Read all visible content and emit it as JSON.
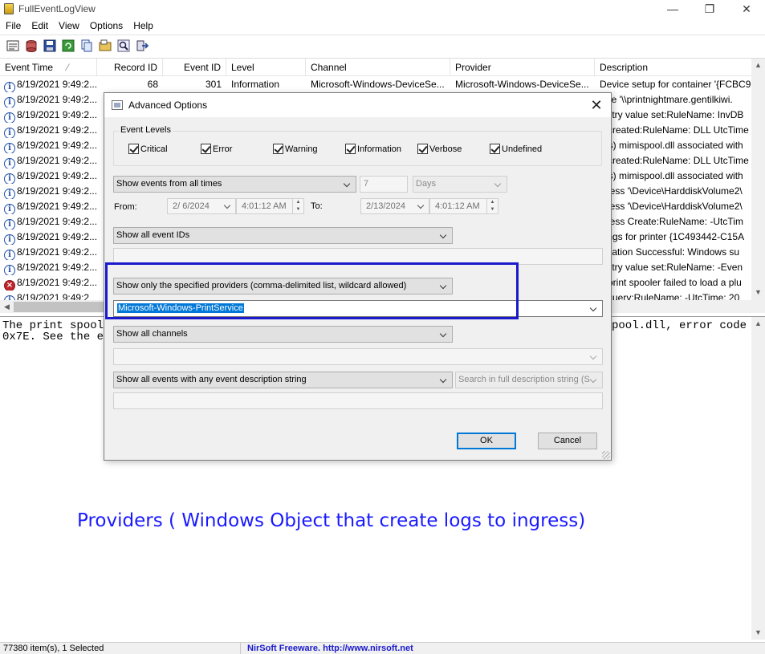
{
  "app": {
    "title": "FullEventLogView",
    "window_buttons": {
      "minimize": "—",
      "maximize": "❐",
      "close": "✕"
    }
  },
  "menu": [
    "File",
    "Edit",
    "View",
    "Options",
    "Help"
  ],
  "toolbar": {
    "icons": [
      "advanced-options-icon",
      "data-source-icon",
      "save-icon",
      "refresh-icon",
      "copy-icon",
      "properties-icon",
      "find-icon",
      "exit-icon"
    ]
  },
  "list": {
    "columns": [
      {
        "label": "Event Time",
        "sort_indicator": "⁄"
      },
      {
        "label": "Record ID"
      },
      {
        "label": "Event ID"
      },
      {
        "label": "Level"
      },
      {
        "label": "Channel"
      },
      {
        "label": "Provider"
      },
      {
        "label": "Description"
      }
    ],
    "rows": [
      {
        "icon": "info",
        "time": "8/19/2021 9:49:2...",
        "record": "68",
        "event": "301",
        "level": "Information",
        "channel": "Microsoft-Windows-DeviceSe...",
        "provider": "Microsoft-Windows-DeviceSe...",
        "desc": "Device setup for container '{FCBC96"
      },
      {
        "icon": "info",
        "time": "8/19/2021 9:49:2...",
        "record": "",
        "event": "",
        "level": "",
        "channel": "",
        "provider": "",
        "desc": "vice '\\\\printnightmare.gentilkiwi."
      },
      {
        "icon": "info",
        "time": "8/19/2021 9:49:2...",
        "record": "",
        "event": "",
        "level": "",
        "channel": "",
        "provider": "",
        "desc": "gistry value set:RuleName: InvDB"
      },
      {
        "icon": "info",
        "time": "8/19/2021 9:49:2...",
        "record": "",
        "event": "",
        "level": "",
        "channel": "",
        "provider": "",
        "desc": "e created:RuleName: DLL UtcTime"
      },
      {
        "icon": "info",
        "time": "8/19/2021 9:49:2...",
        "record": "",
        "event": "",
        "level": "",
        "channel": "",
        "provider": "",
        "desc": "e(s) mimispool.dll associated with"
      },
      {
        "icon": "info",
        "time": "8/19/2021 9:49:2...",
        "record": "",
        "event": "",
        "level": "",
        "channel": "",
        "provider": "",
        "desc": "e created:RuleName: DLL UtcTime"
      },
      {
        "icon": "info",
        "time": "8/19/2021 9:49:2...",
        "record": "",
        "event": "",
        "level": "",
        "channel": "",
        "provider": "",
        "desc": "e(s) mimispool.dll associated with"
      },
      {
        "icon": "info",
        "time": "8/19/2021 9:49:2...",
        "record": "",
        "event": "",
        "level": "",
        "channel": "",
        "provider": "",
        "desc": "ocess '\\Device\\HarddiskVolume2\\"
      },
      {
        "icon": "info",
        "time": "8/19/2021 9:49:2...",
        "record": "",
        "event": "",
        "level": "",
        "channel": "",
        "provider": "",
        "desc": "ocess '\\Device\\HarddiskVolume2\\"
      },
      {
        "icon": "info",
        "time": "8/19/2021 9:49:2...",
        "record": "",
        "event": "",
        "level": "",
        "channel": "",
        "provider": "",
        "desc": "ocess Create:RuleName: -UtcTim"
      },
      {
        "icon": "info",
        "time": "8/19/2021 9:49:2...",
        "record": "",
        "event": "",
        "level": "",
        "channel": "",
        "provider": "",
        "desc": "ttings for printer {1C493442-C15A"
      },
      {
        "icon": "info",
        "time": "8/19/2021 9:49:2...",
        "record": "",
        "event": "",
        "level": "",
        "channel": "",
        "provider": "",
        "desc": "tallation Successful: Windows su"
      },
      {
        "icon": "info",
        "time": "8/19/2021 9:49:2...",
        "record": "",
        "event": "",
        "level": "",
        "channel": "",
        "provider": "",
        "desc": "gistry value set:RuleName: -Even"
      },
      {
        "icon": "error",
        "time": "8/19/2021 9:49:2...",
        "record": "",
        "event": "",
        "level": "",
        "channel": "",
        "provider": "",
        "desc": "e print spooler failed to load a plu"
      },
      {
        "icon": "info",
        "time": "8/19/2021 9:49:2",
        "record": "",
        "event": "",
        "level": "",
        "channel": "",
        "provider": "",
        "desc": "s query:RuleName: -UtcTime: 20"
      }
    ]
  },
  "lower_pane": {
    "line1_left": "The print spoole",
    "line1_right": "pool.dll, error code",
    "line2_left": "0x7E. See the ev"
  },
  "annotation": "Providers ( Windows Object that create logs to ingress)",
  "status": {
    "items": "77380 item(s), 1 Selected",
    "credit": "NirSoft Freeware.  http://www.nirsoft.net"
  },
  "dialog": {
    "title": "Advanced Options",
    "close": "✕",
    "event_levels_label": "Event Levels",
    "levels": [
      {
        "label": "Critical",
        "checked": true
      },
      {
        "label": "Error",
        "checked": true
      },
      {
        "label": "Warning",
        "checked": true
      },
      {
        "label": "Information",
        "checked": true
      },
      {
        "label": "Verbose",
        "checked": true
      },
      {
        "label": "Undefined",
        "checked": true
      }
    ],
    "time_mode": "Show events from all times",
    "time_number": "7",
    "time_unit": "Days",
    "from_label": "From:",
    "from_date": "2/ 6/2024",
    "from_time": "4:01:12 AM",
    "to_label": "To:",
    "to_date": "2/13/2024",
    "to_time": "4:01:12 AM",
    "event_ids_mode": "Show all event IDs",
    "event_ids_value": "",
    "providers_mode": "Show only the specified providers (comma-delimited list, wildcard allowed)",
    "providers_value": "Microsoft-Windows-PrintService",
    "channels_mode": "Show all channels",
    "channels_value": "",
    "description_mode": "Show all events with any event description string",
    "description_search_mode": "Search in full description string (S",
    "description_value": "",
    "ok_label": "OK",
    "cancel_label": "Cancel"
  },
  "colors": {
    "annotation": "#1a1aff",
    "highlight_box": "#1a1acc",
    "selection": "#0078d7"
  }
}
